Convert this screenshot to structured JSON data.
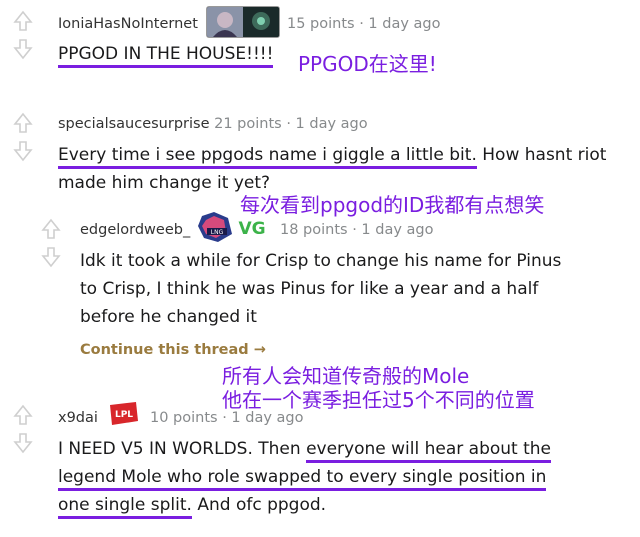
{
  "comments": [
    {
      "user": "IoniaHasNoInternet",
      "points": "15 points",
      "time": "1 day ago",
      "body_underlined": "PPGOD IN THE HOUSE!!!!",
      "body_rest": "",
      "annotation": "PPGOD在这里!"
    },
    {
      "user": "specialsaucesurprise",
      "points": "21 points",
      "time": "1 day ago",
      "body_underlined": "Every time i see ppgods name i giggle a little bit.",
      "body_rest": "How hasnt riot made him change it yet?",
      "annotation": "每次看到ppgod的ID我都有点想笑"
    },
    {
      "user": "edgelordweeb_",
      "points": "18 points",
      "time": "1 day ago",
      "body_line1": "Idk it took a while for Crisp to change his name for Pinus",
      "body_line2": "to Crisp, I think he was Pinus for like a year and a half",
      "body_line3": "before he changed it",
      "continue_label": "Continue this thread",
      "flair_text": "VG"
    },
    {
      "user": "x9dai",
      "points": "10 points",
      "time": "1 day ago",
      "body_p1": "I NEED V5 IN WORLDS. Then ",
      "body_u1": "everyone will hear about the",
      "body_u2": "legend Mole who role swapped to every single position in",
      "body_u3": "one single split.",
      "body_p2": " And ofc ppgod.",
      "flair_text": "LPL",
      "annotation_line1": "所有人会知道传奇般的Mole",
      "annotation_line2": "他在一个赛季担任过5个不同的位置"
    }
  ],
  "separator": "·",
  "arrow": "→",
  "colors": {
    "annotation": "#7a1ee0",
    "continue": "#9a7b3f",
    "vg_green": "#3cb34a",
    "lpl_red": "#d8262b"
  }
}
